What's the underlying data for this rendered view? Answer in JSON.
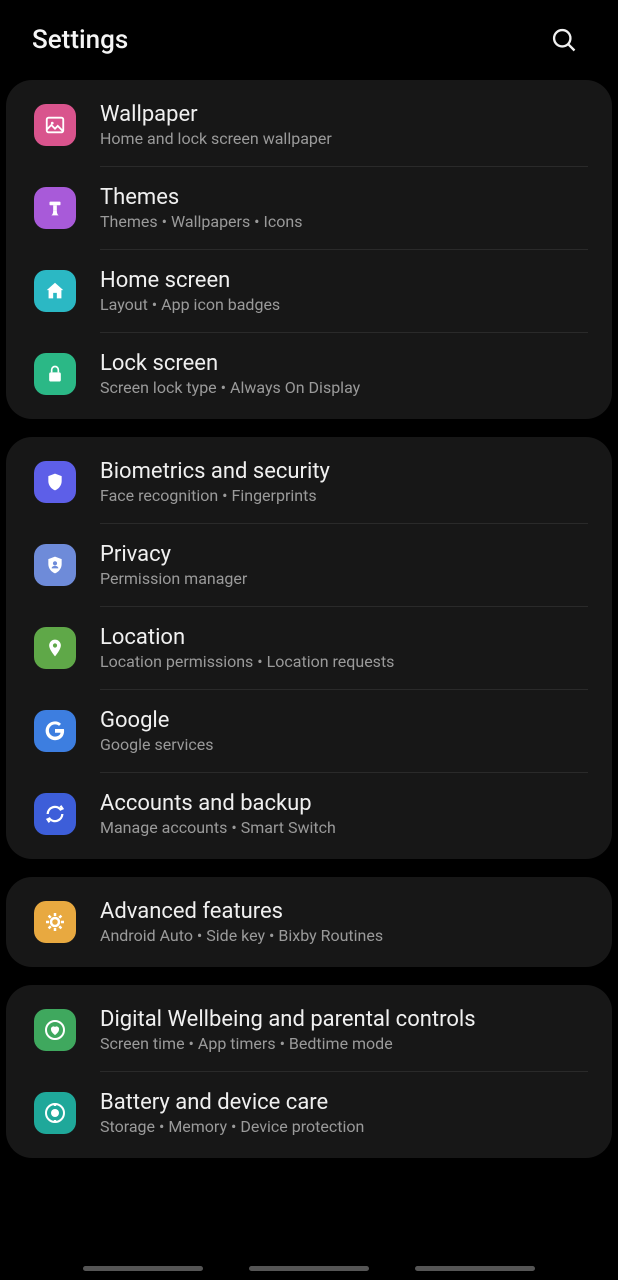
{
  "header": {
    "title": "Settings"
  },
  "groups": [
    {
      "items": [
        {
          "id": "wallpaper",
          "title": "Wallpaper",
          "subtitle": "Home and lock screen wallpaper",
          "icon": "image-icon",
          "color": "#d9548d"
        },
        {
          "id": "themes",
          "title": "Themes",
          "subtitle": "Themes  •  Wallpapers  •  Icons",
          "icon": "brush-icon",
          "color": "#a85ad9"
        },
        {
          "id": "home-screen",
          "title": "Home screen",
          "subtitle": "Layout  •  App icon badges",
          "icon": "home-icon",
          "color": "#2bb8c4"
        },
        {
          "id": "lock-screen",
          "title": "Lock screen",
          "subtitle": "Screen lock type  •  Always On Display",
          "icon": "lock-icon",
          "color": "#2bb886"
        }
      ]
    },
    {
      "items": [
        {
          "id": "biometrics",
          "title": "Biometrics and security",
          "subtitle": "Face recognition  •  Fingerprints",
          "icon": "shield-icon",
          "color": "#5d5fe8"
        },
        {
          "id": "privacy",
          "title": "Privacy",
          "subtitle": "Permission manager",
          "icon": "privacy-icon",
          "color": "#6e8bd9"
        },
        {
          "id": "location",
          "title": "Location",
          "subtitle": "Location permissions  •  Location requests",
          "icon": "pin-icon",
          "color": "#5fa848"
        },
        {
          "id": "google",
          "title": "Google",
          "subtitle": "Google services",
          "icon": "google-icon",
          "color": "#3d7ee0"
        },
        {
          "id": "accounts",
          "title": "Accounts and backup",
          "subtitle": "Manage accounts  •  Smart Switch",
          "icon": "sync-icon",
          "color": "#3d5ed9"
        }
      ]
    },
    {
      "items": [
        {
          "id": "advanced",
          "title": "Advanced features",
          "subtitle": "Android Auto  •  Side key  •  Bixby Routines",
          "icon": "gear-plus-icon",
          "color": "#e8a940"
        }
      ]
    },
    {
      "items": [
        {
          "id": "wellbeing",
          "title": "Digital Wellbeing and parental controls",
          "subtitle": "Screen time  •  App timers  •  Bedtime mode",
          "icon": "wellbeing-icon",
          "color": "#3fa85e"
        },
        {
          "id": "battery",
          "title": "Battery and device care",
          "subtitle": "Storage  •  Memory  •  Device protection",
          "icon": "care-icon",
          "color": "#1fa89a"
        }
      ]
    }
  ]
}
